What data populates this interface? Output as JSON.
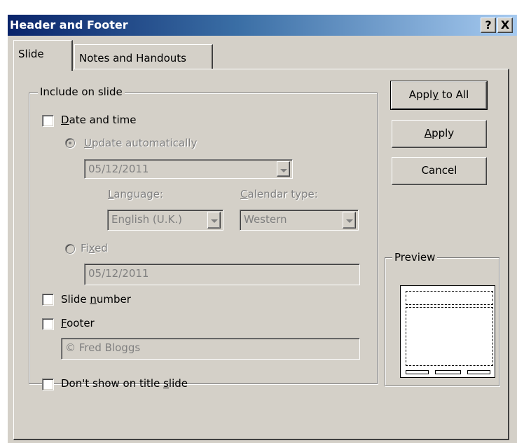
{
  "dialog": {
    "title": "Header and Footer",
    "help_label": "?",
    "close_label": "X"
  },
  "tabs": [
    {
      "label": "Slide",
      "active": true
    },
    {
      "label": "Notes and Handouts",
      "active": false
    }
  ],
  "include_group": {
    "legend": "Include on slide",
    "date_time": {
      "label_ul": "D",
      "label_rest": "ate and time",
      "checked": false
    },
    "update_automatically": {
      "label_ul": "U",
      "label_rest": "pdate automatically",
      "selected": true,
      "enabled": false
    },
    "auto_date_value": "05/12/2011",
    "language": {
      "label_ul": "L",
      "label_rest": "anguage:",
      "value": "English (U.K.)"
    },
    "calendar_type": {
      "label_ul": "C",
      "label_rest": "alendar type:",
      "value": "Western"
    },
    "fixed": {
      "label_pre": "Fi",
      "label_ul": "x",
      "label_post": "ed",
      "selected": false,
      "enabled": false
    },
    "fixed_date_value": "05/12/2011",
    "slide_number": {
      "label_pre": "Slide ",
      "label_ul": "n",
      "label_post": "umber",
      "checked": false
    },
    "footer": {
      "label_ul": "F",
      "label_rest": "ooter",
      "checked": false,
      "value": "© Fred Bloggs"
    }
  },
  "dont_show_title": {
    "label_pre": "Don't show on title ",
    "label_ul": "s",
    "label_post": "lide",
    "checked": false
  },
  "buttons": {
    "apply_to_all": {
      "pre": "Appl",
      "ul": "y",
      "post": " to All"
    },
    "apply": {
      "ul": "A",
      "post": "pply"
    },
    "cancel": {
      "label": "Cancel"
    }
  },
  "preview": {
    "legend": "Preview"
  },
  "colors": {
    "dialog_face": "#d4d0c8",
    "titlebar_start": "#0a246a",
    "titlebar_end": "#a6caf0",
    "disabled_text": "#808080"
  }
}
